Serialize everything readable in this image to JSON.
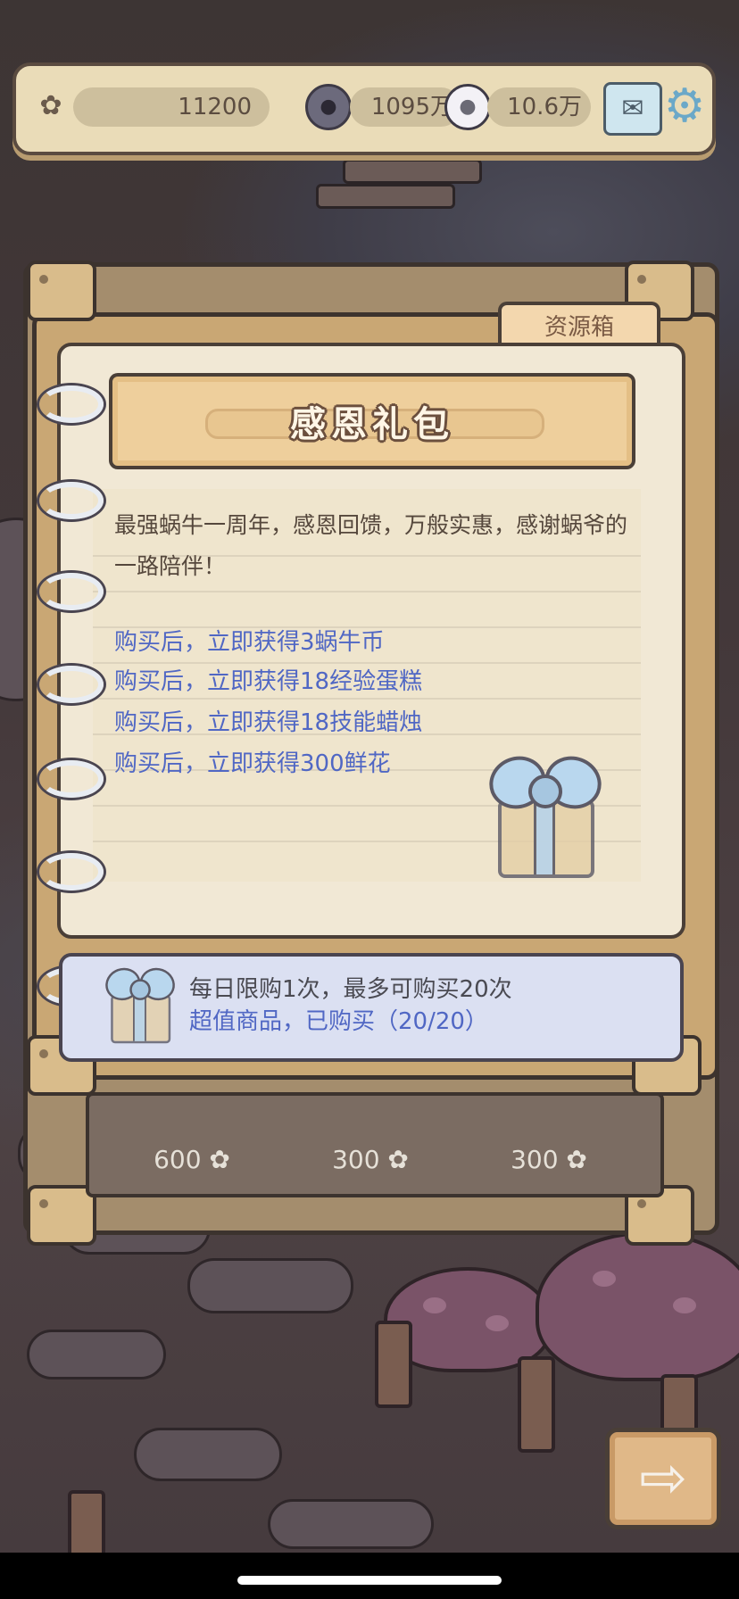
{
  "topbar": {
    "currency_flower": "11200",
    "currency_dark": "1095万",
    "currency_light": "10.6万",
    "icons": [
      "flower-icon",
      "dark-snail-coin-icon",
      "light-snail-coin-icon",
      "mail-icon",
      "gear-icon"
    ]
  },
  "tab": {
    "label": "资源箱"
  },
  "gift_pack": {
    "title": "感恩礼包",
    "description": "最强蜗牛一周年，感恩回馈，万般实惠，感谢蜗爷的一路陪伴！",
    "benefits": [
      "购买后，立即获得3蜗牛币",
      "购买后，立即获得18经验蛋糕",
      "购买后，立即获得18技能蜡烛",
      "购买后，立即获得300鲜花"
    ]
  },
  "purchase": {
    "limit_text": "每日限购1次，最多可购买20次",
    "status_text": "超值商品，已购买（20/20）"
  },
  "shop_prices": [
    "600",
    "300",
    "300"
  ],
  "next_button": {
    "icon": "arrow-right-icon",
    "glyph": "⇨"
  },
  "colors": {
    "accent_blue": "#5067c4",
    "paper": "#f1e8d5",
    "frame": "#c9a774"
  }
}
